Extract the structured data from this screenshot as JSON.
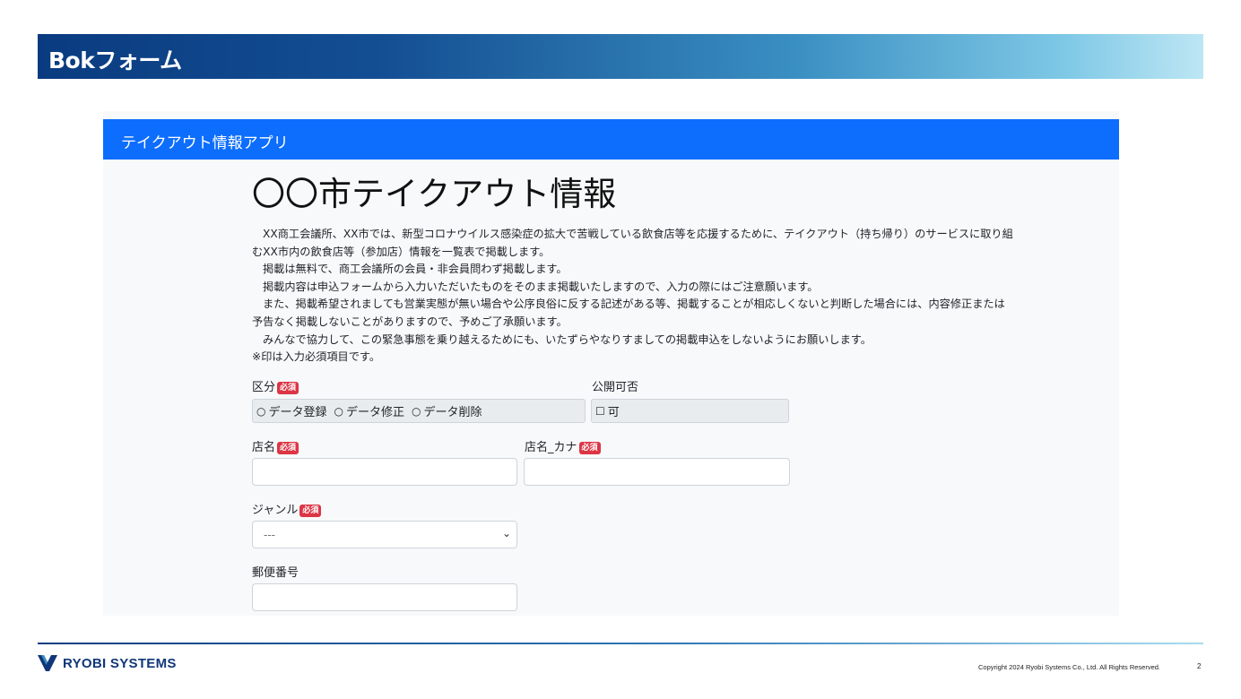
{
  "slide": {
    "title": "Bokフォーム",
    "header_gradient": [
      "#0a3b80",
      "#bde6f4"
    ]
  },
  "app": {
    "brand": "テイクアウト情報アプリ",
    "navbar_color": "#0d6efd",
    "heading": "〇〇市テイクアウト情報",
    "intro": {
      "line1": "XX商工会議所、XX市では、新型コロナウイルス感染症の拡大で苦戦している飲食店等を応援するために、テイクアウト（持ち帰り）のサービスに取り組",
      "line2": "むXX市内の飲食店等（参加店）情報を一覧表で掲載します。",
      "line3": "掲載は無料で、商工会議所の会員・非会員問わず掲載します。",
      "line4": "掲載内容は申込フォームから入力いただいたものをそのまま掲載いたしますので、入力の際にはご注意願います。",
      "line5": "また、掲載希望されましても営業実態が無い場合や公序良俗に反する記述がある等、掲載することが相応しくないと判断した場合には、内容修正または",
      "line6": "予告なく掲載しないことがありますので、予めご了承願います。",
      "line7": "みんなで協力して、この緊急事態を乗り越えるためにも、いたずらやなりすましての掲載申込をしないようにお願いします。",
      "line8": "※印は入力必須項目です。"
    },
    "required_badge": "必須",
    "form": {
      "category_label": "区分",
      "category_options": [
        "データ登録",
        "データ修正",
        "データ削除"
      ],
      "publish_label": "公開可否",
      "publish_option": "可",
      "store_name_label": "店名",
      "store_name_value": "",
      "store_kana_label": "店名_カナ",
      "store_kana_value": "",
      "genre_label": "ジャンル",
      "genre_selected": "---",
      "postal_label": "郵便番号",
      "postal_value": ""
    }
  },
  "footer": {
    "logo_text": "RYOBI SYSTEMS",
    "copyright": "Copyright 2024 Ryobi Systems Co., Ltd. All Rights Reserved.",
    "page_number": "2"
  }
}
